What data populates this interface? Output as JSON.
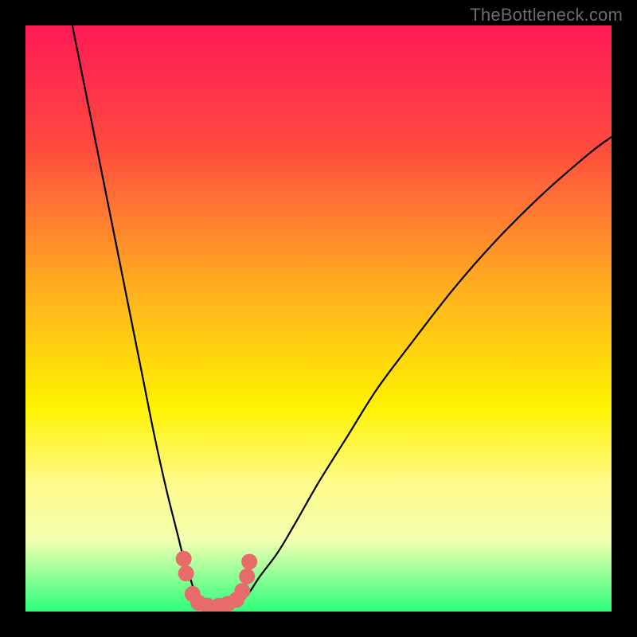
{
  "watermark": "TheBottleneck.com",
  "chart_data": {
    "type": "line",
    "title": "",
    "xlabel": "",
    "ylabel": "",
    "xlim": [
      0,
      100
    ],
    "ylim": [
      0,
      100
    ],
    "background_gradient": {
      "stops": [
        {
          "offset": 0,
          "color": "#ff1a55"
        },
        {
          "offset": 20,
          "color": "#ff4840"
        },
        {
          "offset": 45,
          "color": "#ffb020"
        },
        {
          "offset": 65,
          "color": "#fff200"
        },
        {
          "offset": 78,
          "color": "#fffb8a"
        },
        {
          "offset": 88,
          "color": "#f0ffb0"
        },
        {
          "offset": 100,
          "color": "#2bff7a"
        }
      ]
    },
    "series": [
      {
        "name": "left-curve",
        "x": [
          8,
          10,
          12,
          14,
          16,
          18,
          20,
          22,
          24,
          26,
          27,
          28,
          29,
          30
        ],
        "y": [
          100,
          90,
          80,
          70,
          60,
          50,
          40,
          30,
          21,
          13,
          9,
          6,
          3,
          1
        ]
      },
      {
        "name": "right-curve",
        "x": [
          36,
          38,
          40,
          43,
          46,
          50,
          55,
          60,
          66,
          73,
          80,
          88,
          96,
          100
        ],
        "y": [
          1,
          3,
          6,
          10,
          15,
          22,
          30,
          38,
          46,
          55,
          63,
          71,
          78,
          81
        ]
      }
    ],
    "markers": {
      "name": "bottom-dots",
      "color": "#e86b6b",
      "radius": 10,
      "points": [
        {
          "x": 27.0,
          "y": 9.0
        },
        {
          "x": 27.4,
          "y": 6.5
        },
        {
          "x": 28.5,
          "y": 3.0
        },
        {
          "x": 29.5,
          "y": 1.5
        },
        {
          "x": 31.0,
          "y": 1.0
        },
        {
          "x": 33.0,
          "y": 1.0
        },
        {
          "x": 34.5,
          "y": 1.3
        },
        {
          "x": 36.0,
          "y": 2.0
        },
        {
          "x": 37.0,
          "y": 3.5
        },
        {
          "x": 37.8,
          "y": 6.0
        },
        {
          "x": 38.2,
          "y": 8.5
        }
      ]
    }
  }
}
